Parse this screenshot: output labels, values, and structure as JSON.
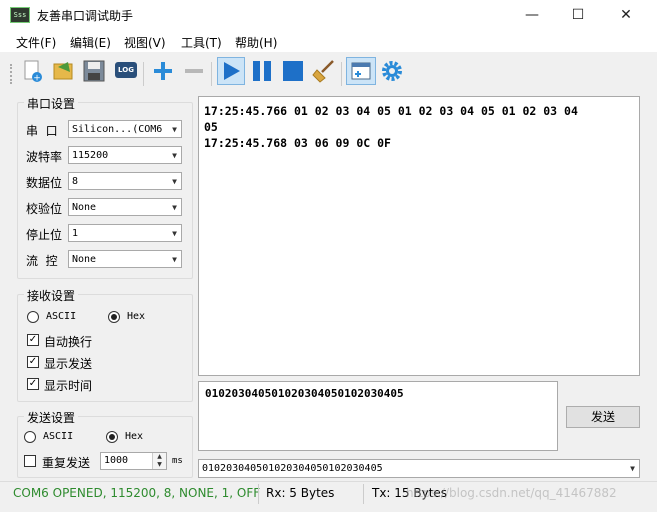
{
  "window": {
    "title": "友善串口调试助手",
    "minimize": "—",
    "maximize": "☐",
    "close": "✕",
    "icon_text": "Sss"
  },
  "menu": [
    "文件(F)",
    "编辑(E)",
    "视图(V)",
    "工具(T)",
    "帮助(H)"
  ],
  "toolbar": {
    "log_label": "LOG"
  },
  "serial_settings": {
    "title": "串口设置",
    "rows": [
      {
        "label": "串  口",
        "value": "Silicon...(COM6"
      },
      {
        "label": "波特率",
        "value": "115200"
      },
      {
        "label": "数据位",
        "value": "8"
      },
      {
        "label": "校验位",
        "value": "None"
      },
      {
        "label": "停止位",
        "value": "1"
      },
      {
        "label": "流  控",
        "value": "None"
      }
    ]
  },
  "receive_settings": {
    "title": "接收设置",
    "ascii": "ASCII",
    "hex": "Hex",
    "selected": "Hex",
    "auto_wrap": "自动换行",
    "show_send": "显示发送",
    "show_time": "显示时间"
  },
  "send_settings": {
    "title": "发送设置",
    "ascii": "ASCII",
    "hex": "Hex",
    "selected": "Hex",
    "repeat_send": "重复发送",
    "repeat_interval": "1000",
    "unit": "ms"
  },
  "receive_area": {
    "lines": [
      "17:25:45.766 01 02 03 04 05 01 02 03 04 05 01 02 03 04",
      "05",
      "17:25:45.768 03 06 09 0C 0F"
    ]
  },
  "send_area": {
    "text": "010203040501020304050102030405",
    "send_button": "发送"
  },
  "history": {
    "value": "010203040501020304050102030405"
  },
  "status": {
    "connection": "COM6 OPENED, 115200, 8, NONE, 1, OFF",
    "rx": "Rx: 5 Bytes",
    "tx": "Tx: 15 Bytes",
    "watermark": "https://blog.csdn.net/qq_41467882"
  },
  "colors": {
    "status_green": "#2e8b2e",
    "play_blue": "#1e70c8"
  }
}
